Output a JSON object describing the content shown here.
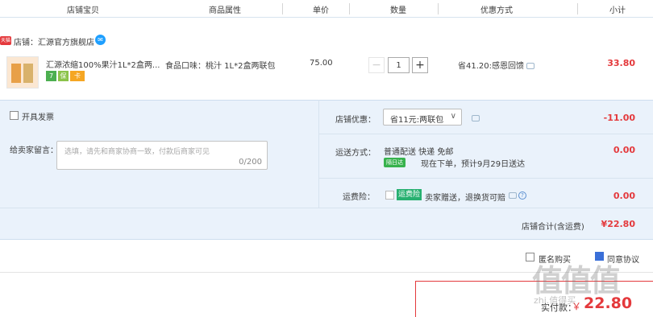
{
  "header": {
    "columns": [
      "店铺宝贝",
      "商品属性",
      "单价",
      "数量",
      "优惠方式",
      "小计"
    ]
  },
  "store": {
    "badge": "天猫",
    "name": "店铺：汇源官方旗舰店"
  },
  "item": {
    "title": "汇源浓缩100%果汁1L*2盒两...",
    "service_icons": [
      "7",
      "保",
      "卡"
    ],
    "attribute": "食品口味：桃汁 1L*2盒两联包",
    "unit_price": "75.00",
    "quantity": "1",
    "quantity_minus": "−",
    "quantity_plus": "+",
    "discount": "省41.20:感恩回馈",
    "subtotal": "33.80"
  },
  "summary": {
    "invoice_label": "开具发票",
    "message_label": "给卖家留言：",
    "message_placeholder": "选填，请先和商家协商一致，付款后商家可见",
    "message_count": "0/200",
    "store_discount_label": "店铺优惠：",
    "store_discount_select": "省11元:两联包",
    "store_discount_value": "-11.00",
    "shipping_label": "运送方式：",
    "shipping_method": "普通配送 快递 免邮",
    "shipping_badge": "隔日达",
    "shipping_note": "现在下单，预计9月29日送达",
    "shipping_value": "0.00",
    "insurance_label": "运费险：",
    "insurance_badge": "运费险",
    "insurance_text": "卖家赠送，退换货可赔",
    "insurance_value": "0.00",
    "store_total_label": "店铺合计(含运费)",
    "store_total_value": "¥22.80"
  },
  "footer": {
    "option1": "匿名购买",
    "option2": "同意协议",
    "pay_label": "实付款：",
    "pay_currency": "￥",
    "pay_amount": "22.80",
    "watermark": "值值值",
    "watermark_url": "zhi.值得买"
  },
  "colors": {
    "accent": "#e4393c",
    "panel_bg": "#eaf2fb",
    "green": "#37b24d"
  }
}
